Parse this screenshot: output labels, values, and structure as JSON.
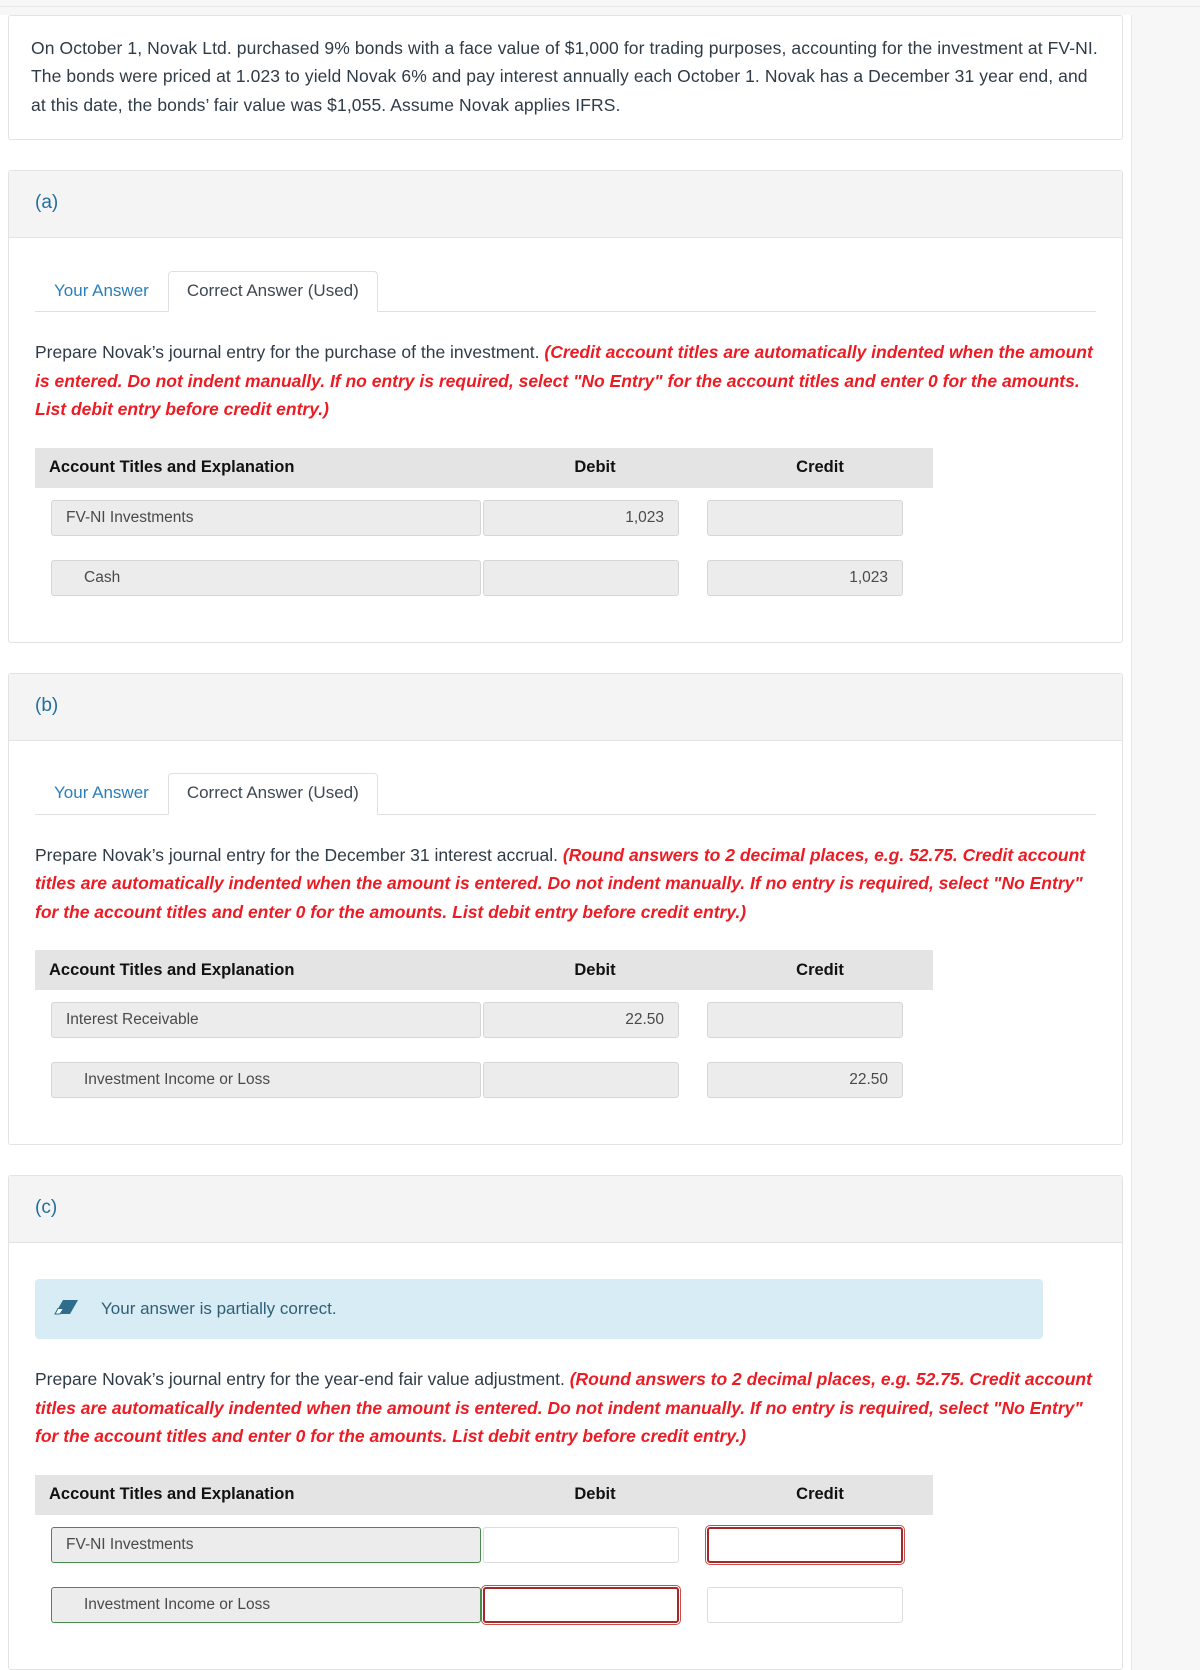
{
  "prompt": {
    "text": "On October 1, Novak Ltd. purchased 9% bonds with a face value of $1,000 for trading purposes, accounting for the investment at FV-NI. The bonds were priced at 1.023 to yield Novak 6% and pay interest annually each October 1. Novak has a December 31 year end, and at this date, the bonds’ fair value was $1,055. Assume Novak applies IFRS."
  },
  "colors": {
    "link": "#2a7fb8",
    "hint_red": "#ec1c24",
    "alert_bg": "#d8ecf5",
    "alert_text": "#2f5f75",
    "correct_green": "#4a8a4c",
    "incorrect_red": "#a62727"
  },
  "table_headers": {
    "account": "Account Titles and Explanation",
    "debit": "Debit",
    "credit": "Credit"
  },
  "parts": [
    {
      "label": "(a)",
      "tabs": [
        {
          "label": "Your Answer",
          "active": false
        },
        {
          "label": "Correct Answer (Used)",
          "active": true
        }
      ],
      "instruction_main": "Prepare Novak’s journal entry for the purchase of the investment.",
      "instruction_hint": "(Credit account titles are automatically indented when the amount is entered. Do not indent manually. If no entry is required, select \"No Entry\" for the account titles and enter 0 for the amounts. List debit entry before credit entry.)",
      "alert": null,
      "rows": [
        {
          "account": "FV-NI Investments",
          "indent": false,
          "debit": "1,023",
          "credit": "",
          "acct_state": "filled",
          "debit_state": "filled",
          "credit_state": "filled"
        },
        {
          "account": "Cash",
          "indent": true,
          "debit": "",
          "credit": "1,023",
          "acct_state": "filled",
          "debit_state": "filled",
          "credit_state": "filled"
        }
      ]
    },
    {
      "label": "(b)",
      "tabs": [
        {
          "label": "Your Answer",
          "active": false
        },
        {
          "label": "Correct Answer (Used)",
          "active": true
        }
      ],
      "instruction_main": "Prepare Novak’s journal entry for the December 31 interest accrual.",
      "instruction_hint": "(Round answers to 2 decimal places, e.g. 52.75. Credit account titles are automatically indented when the amount is entered. Do not indent manually. If no entry is required, select \"No Entry\" for the account titles and enter 0 for the amounts. List debit entry before credit entry.)",
      "alert": null,
      "rows": [
        {
          "account": "Interest Receivable",
          "indent": false,
          "debit": "22.50",
          "credit": "",
          "acct_state": "filled",
          "debit_state": "filled",
          "credit_state": "filled"
        },
        {
          "account": "Investment Income or Loss",
          "indent": true,
          "debit": "",
          "credit": "22.50",
          "acct_state": "filled",
          "debit_state": "filled",
          "credit_state": "filled"
        }
      ]
    },
    {
      "label": "(c)",
      "tabs": [],
      "instruction_main": "Prepare Novak’s journal entry for the year-end fair value adjustment.",
      "instruction_hint": "(Round answers to 2 decimal places, e.g. 52.75. Credit account titles are automatically indented when the amount is entered. Do not indent manually. If no entry is required, select \"No Entry\" for the account titles and enter 0 for the amounts. List debit entry before credit entry.)",
      "alert": {
        "icon": "eraser-icon",
        "text": "Your answer is partially correct."
      },
      "rows": [
        {
          "account": "FV-NI Investments",
          "indent": false,
          "debit": "",
          "credit": "",
          "acct_state": "correct",
          "debit_state": "open",
          "credit_state": "incorrect"
        },
        {
          "account": "Investment Income or Loss",
          "indent": true,
          "debit": "",
          "credit": "",
          "acct_state": "correct",
          "debit_state": "incorrect",
          "credit_state": "open"
        }
      ]
    }
  ]
}
